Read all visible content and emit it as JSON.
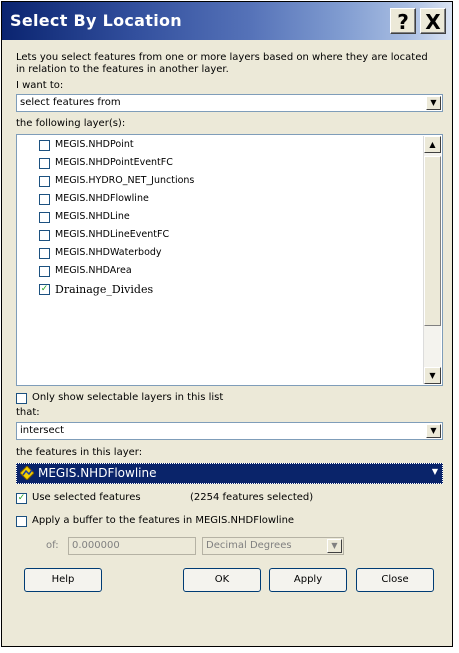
{
  "window": {
    "title": "Select By Location",
    "help_glyph": "?",
    "close_glyph": "X"
  },
  "intro": "Lets you select features from one or more layers based on where they are located in relation to the features in another layer.",
  "i_want_to": {
    "label": "I want to:",
    "value": "select features from"
  },
  "layers": {
    "label": "the following layer(s):",
    "items": [
      {
        "name": "MEGIS.NHDPoint",
        "checked": false
      },
      {
        "name": "MEGIS.NHDPointEventFC",
        "checked": false
      },
      {
        "name": "MEGIS.HYDRO_NET_Junctions",
        "checked": false
      },
      {
        "name": "MEGIS.NHDFlowline",
        "checked": false
      },
      {
        "name": "MEGIS.NHDLine",
        "checked": false
      },
      {
        "name": "MEGIS.NHDLineEventFC",
        "checked": false
      },
      {
        "name": "MEGIS.NHDWaterbody",
        "checked": false
      },
      {
        "name": "MEGIS.NHDArea",
        "checked": false
      },
      {
        "name": "Drainage_Divides",
        "checked": true
      }
    ]
  },
  "only_selectable": {
    "label": "Only show selectable layers in this list",
    "checked": false
  },
  "that": {
    "label": "that:",
    "value": "intersect"
  },
  "source_layer": {
    "label": "the features in this layer:",
    "value": "MEGIS.NHDFlowline"
  },
  "use_selected": {
    "label": "Use selected features",
    "checked": true,
    "count_text": "(2254 features selected)"
  },
  "buffer": {
    "label": "Apply a buffer to the features in MEGIS.NHDFlowline",
    "checked": false,
    "of_label": "of:",
    "distance": "0.000000",
    "units": "Decimal Degrees"
  },
  "buttons": {
    "help": "Help",
    "ok": "OK",
    "apply": "Apply",
    "close": "Close"
  },
  "colors": {
    "dialog_bg": "#ece9d8",
    "title_gradient_start": "#0a2470",
    "selection_bg": "#0a246a",
    "check_green": "#21a121"
  }
}
